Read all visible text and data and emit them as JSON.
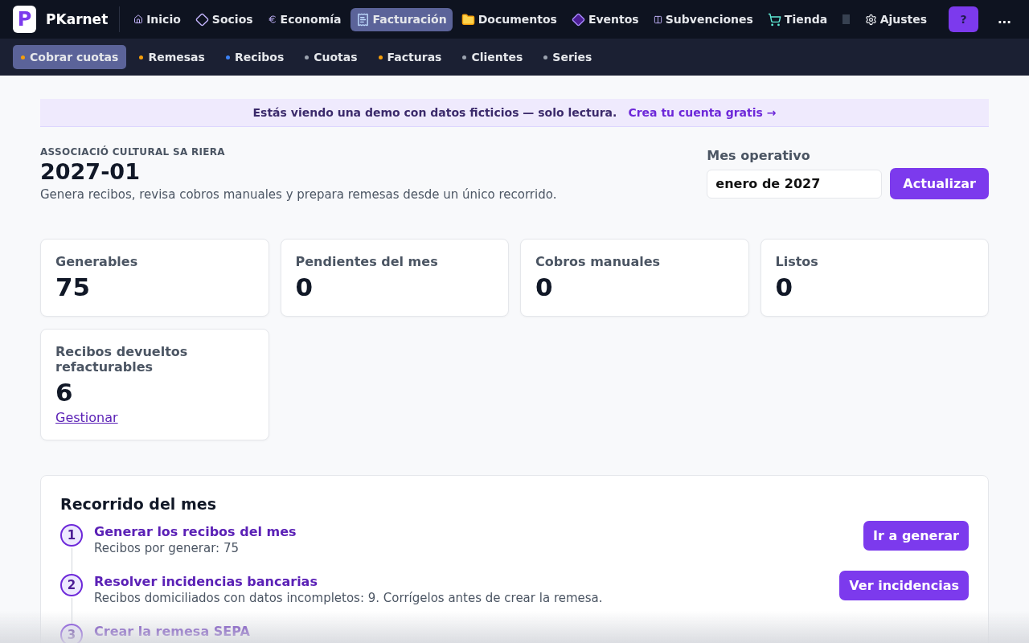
{
  "brand": {
    "name": "PKarnet",
    "logo_letter": "P"
  },
  "nav": [
    {
      "label": "Inicio",
      "selected": false
    },
    {
      "label": "Socios",
      "selected": false
    },
    {
      "label": "Economía",
      "selected": false
    },
    {
      "label": "Facturación",
      "selected": true
    },
    {
      "label": "Documentos",
      "selected": false
    },
    {
      "label": "Eventos",
      "selected": false
    },
    {
      "label": "Subvenciones",
      "selected": false
    },
    {
      "label": "Tienda",
      "selected": false
    },
    {
      "label": "Ajustes",
      "selected": false
    }
  ],
  "help_button": "?",
  "more_button": "...",
  "subnav": [
    {
      "label": "Cobrar cuotas",
      "selected": true,
      "color": "#f59e0b"
    },
    {
      "label": "Remesas",
      "selected": false,
      "color": "#f59e0b"
    },
    {
      "label": "Recibos",
      "selected": false,
      "color": "#3b82f6"
    },
    {
      "label": "Cuotas",
      "selected": false,
      "color": "#9ca3af"
    },
    {
      "label": "Facturas",
      "selected": false,
      "color": "#f59e0b"
    },
    {
      "label": "Clientes",
      "selected": false,
      "color": "#9ca3af"
    },
    {
      "label": "Series",
      "selected": false,
      "color": "#9ca3af"
    }
  ],
  "banner": {
    "text": "Estás viendo una demo con datos ficticios — solo lectura.",
    "link": "Crea tu cuenta gratis →"
  },
  "header": {
    "organization": "ASSOCIACIÓ CULTURAL SA RIERA",
    "title": "2027-01",
    "subtitle": "Genera recibos, revisa cobros manuales y prepara remesas desde un único recorrido.",
    "month_label": "Mes operativo",
    "month_value": "enero de 2027",
    "update_button": "Actualizar"
  },
  "stats": [
    {
      "label": "Generables",
      "value": "75"
    },
    {
      "label": "Pendientes del mes",
      "value": "0"
    },
    {
      "label": "Cobros manuales",
      "value": "0"
    },
    {
      "label": "Listos",
      "value": "0"
    },
    {
      "label": "Recibos devueltos refacturables",
      "value": "6",
      "link": "Gestionar"
    }
  ],
  "journey": {
    "title": "Recorrido del mes",
    "steps": [
      {
        "number": "1",
        "title": "Generar los recibos del mes",
        "description": "Recibos por generar: 75",
        "action": "Ir a generar"
      },
      {
        "number": "2",
        "title": "Resolver incidencias bancarias",
        "description": "Recibos domiciliados con datos incompletos: 9. Corrígelos antes de crear la remesa.",
        "action": "Ver incidencias"
      },
      {
        "number": "3",
        "title": "Crear la remesa SEPA"
      }
    ]
  }
}
